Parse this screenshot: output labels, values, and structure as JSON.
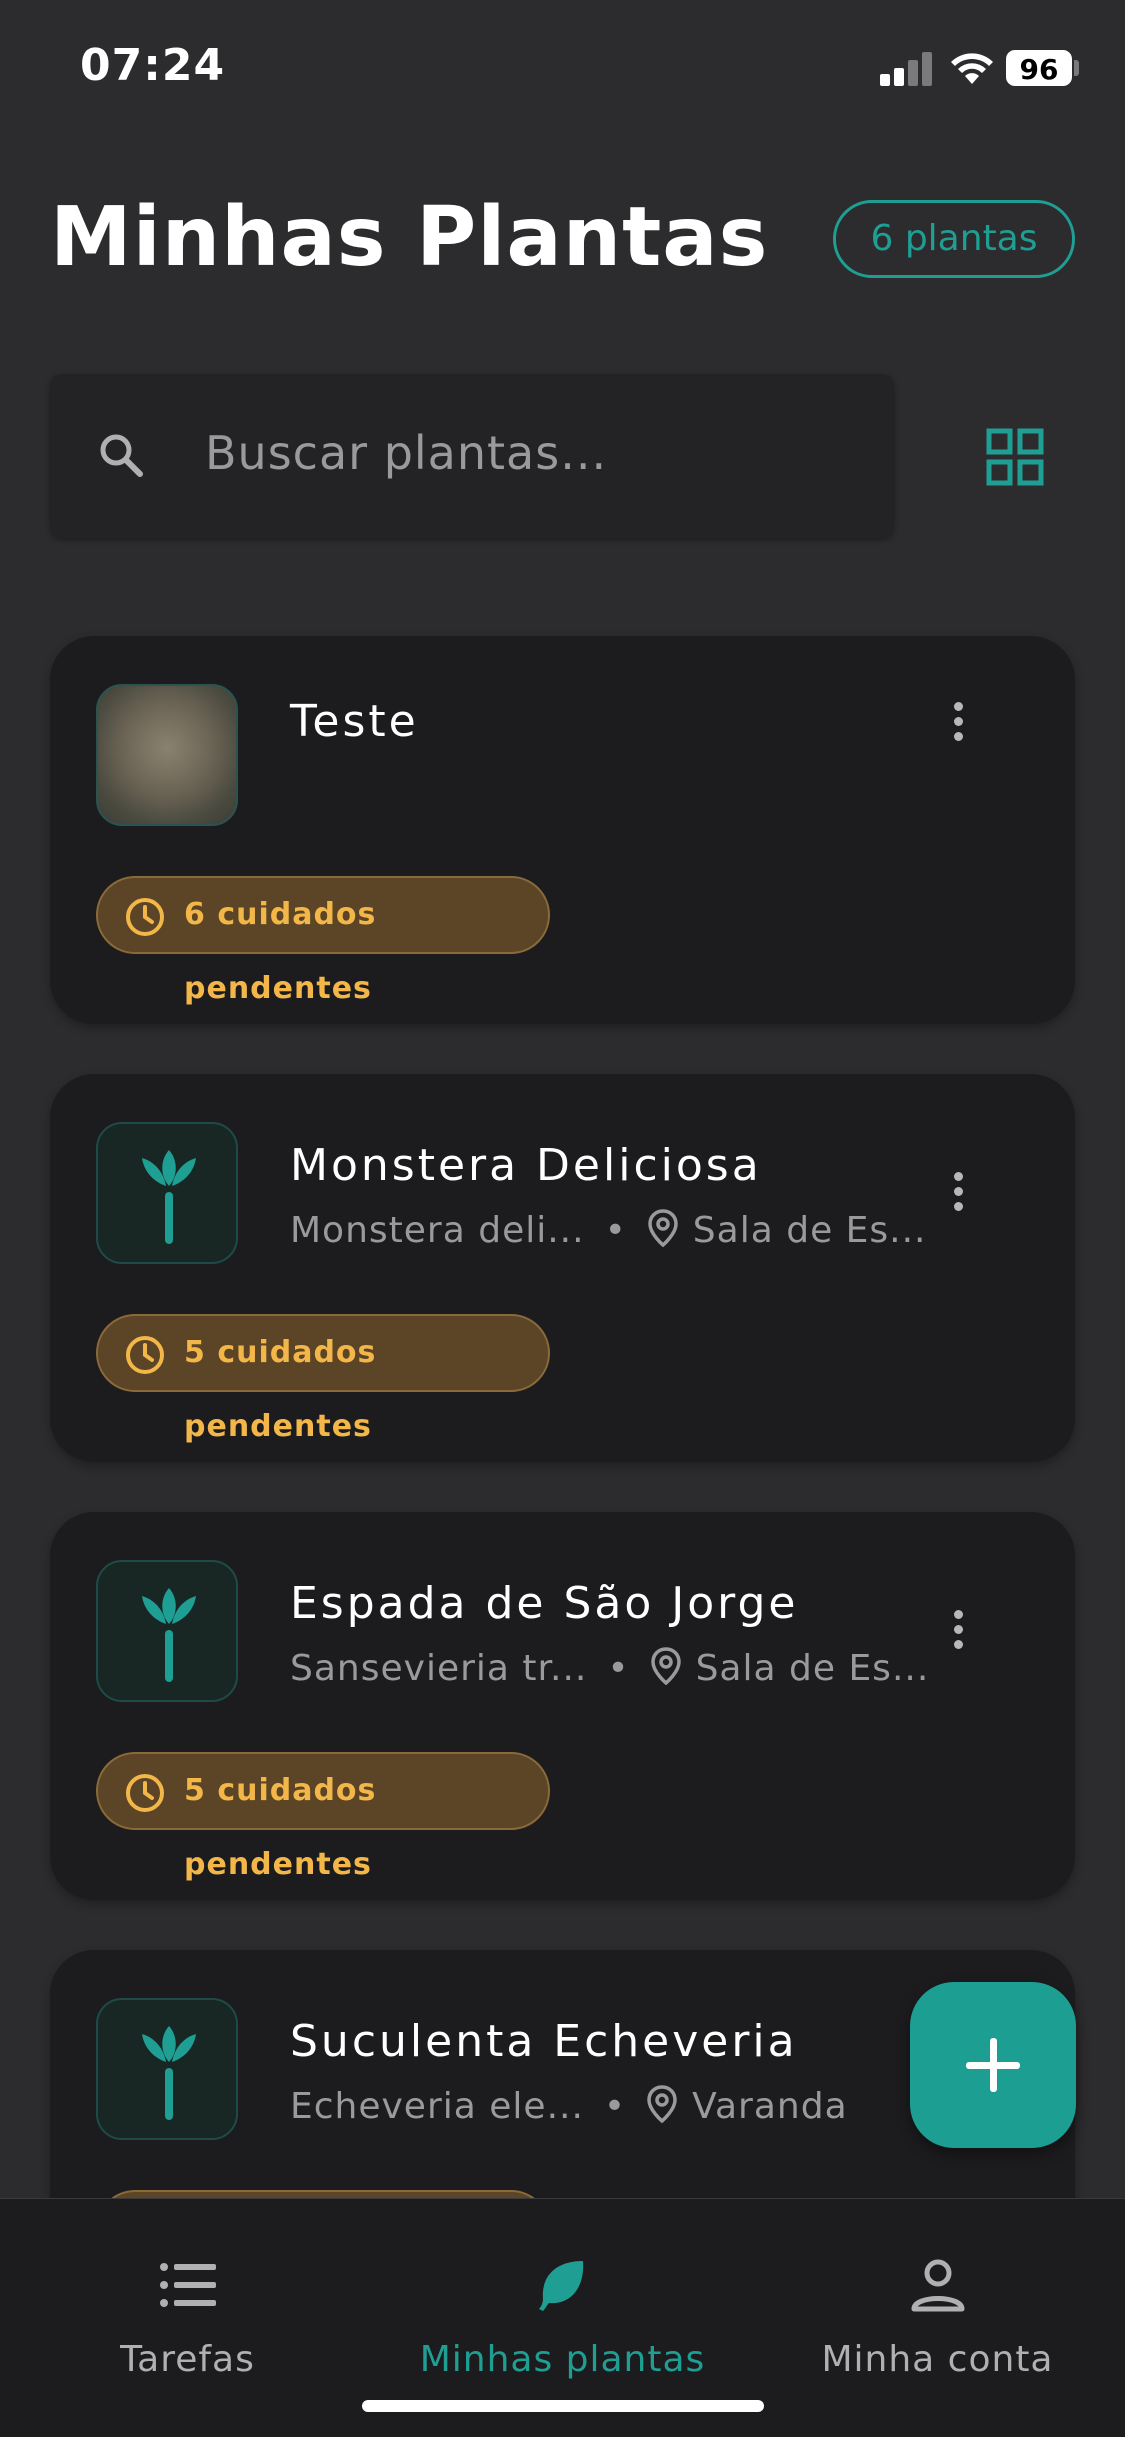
{
  "status_bar": {
    "time": "07:24",
    "battery": "96"
  },
  "header": {
    "title": "Minhas Plantas",
    "count_badge": "6 plantas"
  },
  "search": {
    "placeholder": "Buscar plantas..."
  },
  "plants": [
    {
      "name": "Teste",
      "scientific": "",
      "location": "",
      "pending": "6 cuidados pendentes",
      "thumbnail": "photo"
    },
    {
      "name": "Monstera Deliciosa",
      "scientific": "Monstera deli...",
      "location": "Sala de Es...",
      "pending": "5 cuidados pendentes",
      "thumbnail": "plant-icon"
    },
    {
      "name": "Espada de São Jorge",
      "scientific": "Sansevieria tr...",
      "location": "Sala de Es...",
      "pending": "5 cuidados pendentes",
      "thumbnail": "plant-icon"
    },
    {
      "name": "Suculenta Echeveria",
      "scientific": "Echeveria ele...",
      "location": "Varanda",
      "pending": "",
      "thumbnail": "plant-icon"
    }
  ],
  "bottom_nav": [
    {
      "label": "Tarefas",
      "icon": "list-icon",
      "active": false
    },
    {
      "label": "Minhas plantas",
      "icon": "leaf-icon",
      "active": true
    },
    {
      "label": "Minha conta",
      "icon": "person-icon",
      "active": false
    }
  ],
  "colors": {
    "accent": "#1f9e93",
    "pending_text": "#f3b649",
    "pending_bg": "#5b4526",
    "background": "#2c2c2e",
    "card": "#1c1c1e"
  }
}
